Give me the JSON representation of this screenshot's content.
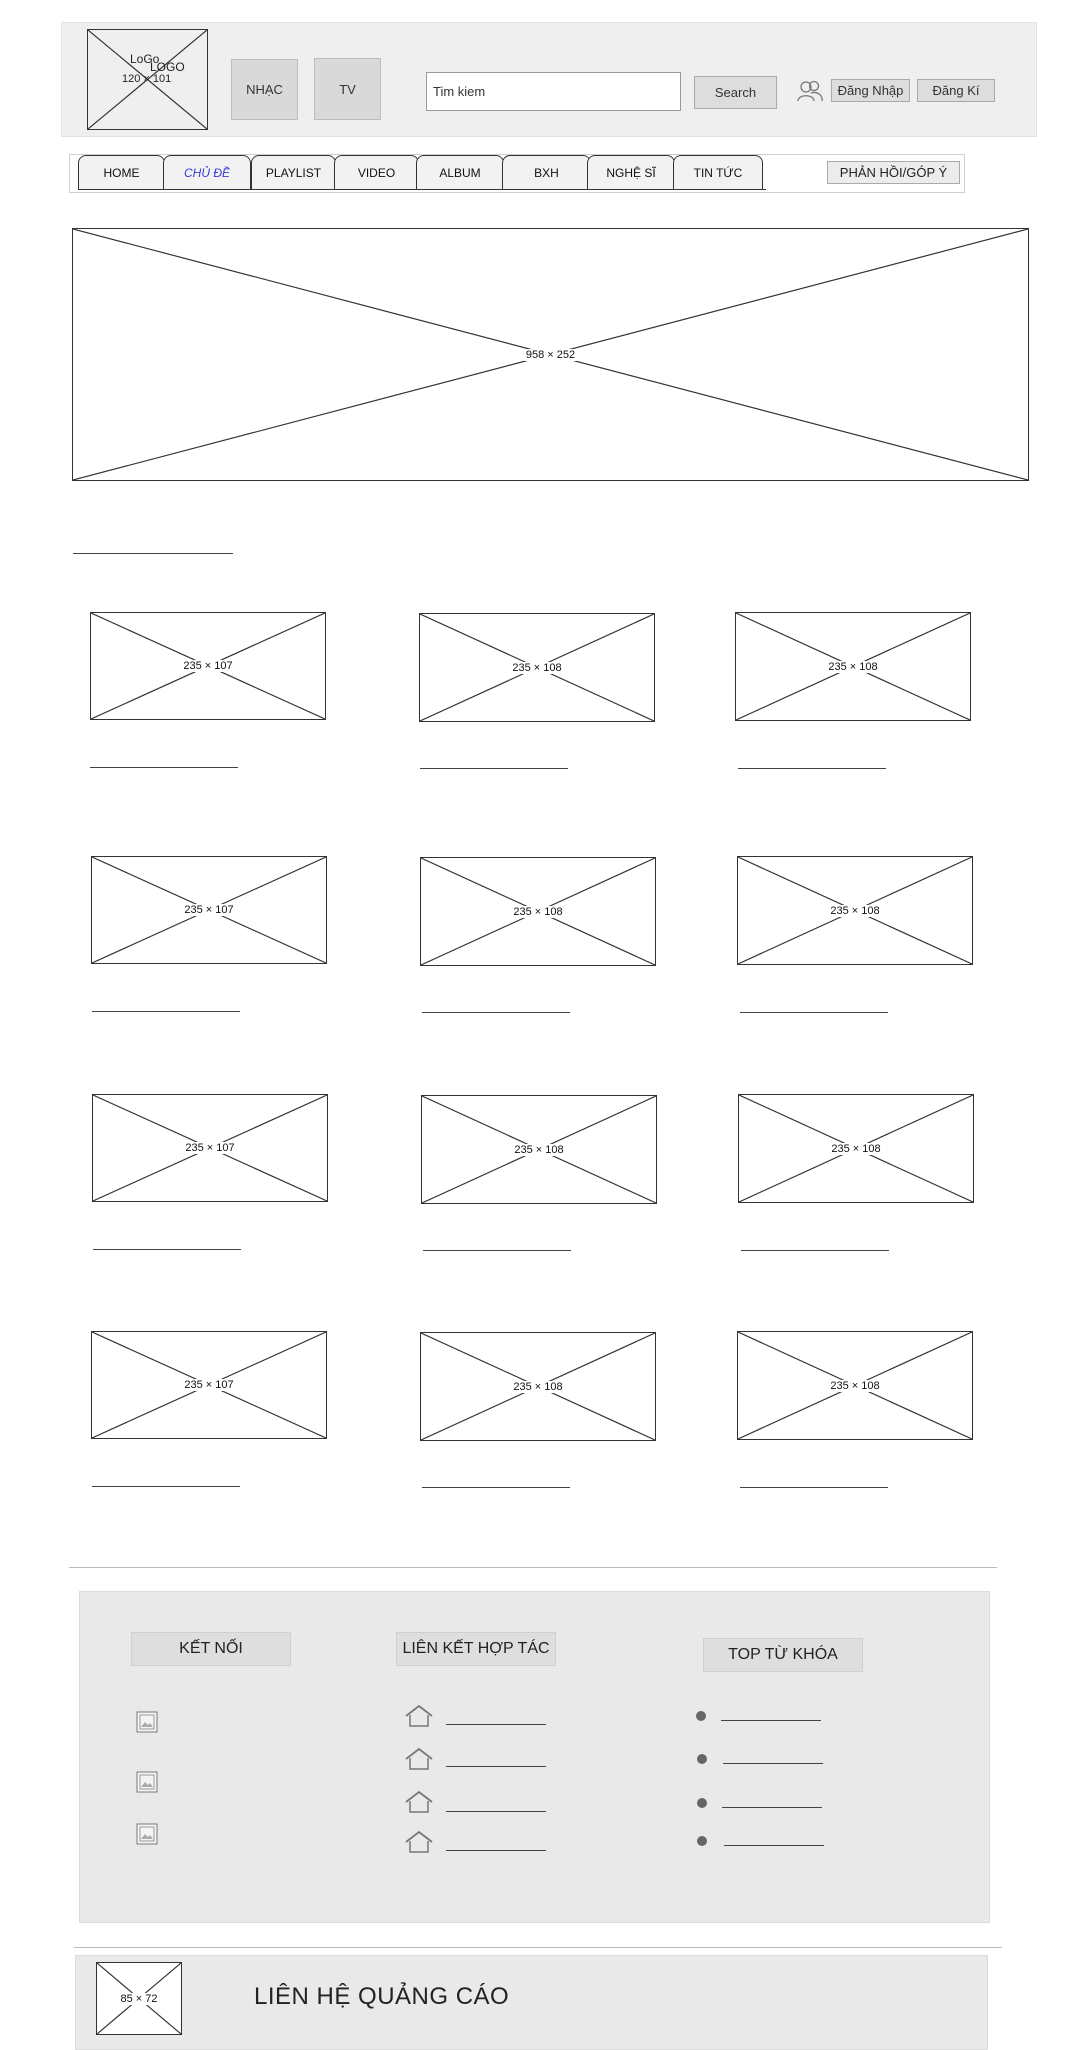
{
  "header": {
    "logo": {
      "text": "LoGo",
      "text2": "LOGO",
      "size": "120 × 101"
    },
    "nav_buttons": [
      {
        "label": "NHẠC"
      },
      {
        "label": "TV"
      }
    ],
    "search": {
      "value": "Tim kiem",
      "button": "Search"
    },
    "account": {
      "login": "Đăng Nhập",
      "register": "Đăng Kí"
    }
  },
  "nav": {
    "tabs": [
      {
        "label": "HOME",
        "active": false
      },
      {
        "label": "CHỦ ĐỀ",
        "active": true
      },
      {
        "label": "PLAYLIST",
        "active": false
      },
      {
        "label": "VIDEO",
        "active": false
      },
      {
        "label": "ALBUM",
        "active": false
      },
      {
        "label": "BXH",
        "active": false
      },
      {
        "label": "NGHỆ SĨ",
        "active": false
      },
      {
        "label": "TIN TỨC",
        "active": false
      }
    ],
    "feedback": "PHẢN HỒI/GÓP Ý",
    "accent": "#3a3ad6"
  },
  "banner": {
    "size": "958 × 252"
  },
  "grid": {
    "rows": [
      [
        "235 × 107",
        "235 × 108",
        "235 × 108"
      ],
      [
        "235 × 107",
        "235 × 108",
        "235 × 108"
      ],
      [
        "235 × 107",
        "235 × 108",
        "235 × 108"
      ],
      [
        "235 × 107",
        "235 × 108",
        "235 × 108"
      ]
    ]
  },
  "footer": {
    "connect": {
      "title": "KẾT NỐI",
      "icon": "image-icon",
      "count": 3
    },
    "partners": {
      "title": "LIÊN KẾT HỢP TÁC",
      "icon": "home-icon",
      "count": 4
    },
    "keywords": {
      "title": "TOP TỪ KHÓA",
      "icon": "bullet-dot",
      "count": 4
    }
  },
  "ads": {
    "logo_size": "85 × 72",
    "title": "LIÊN HỆ QUẢNG CÁO"
  }
}
